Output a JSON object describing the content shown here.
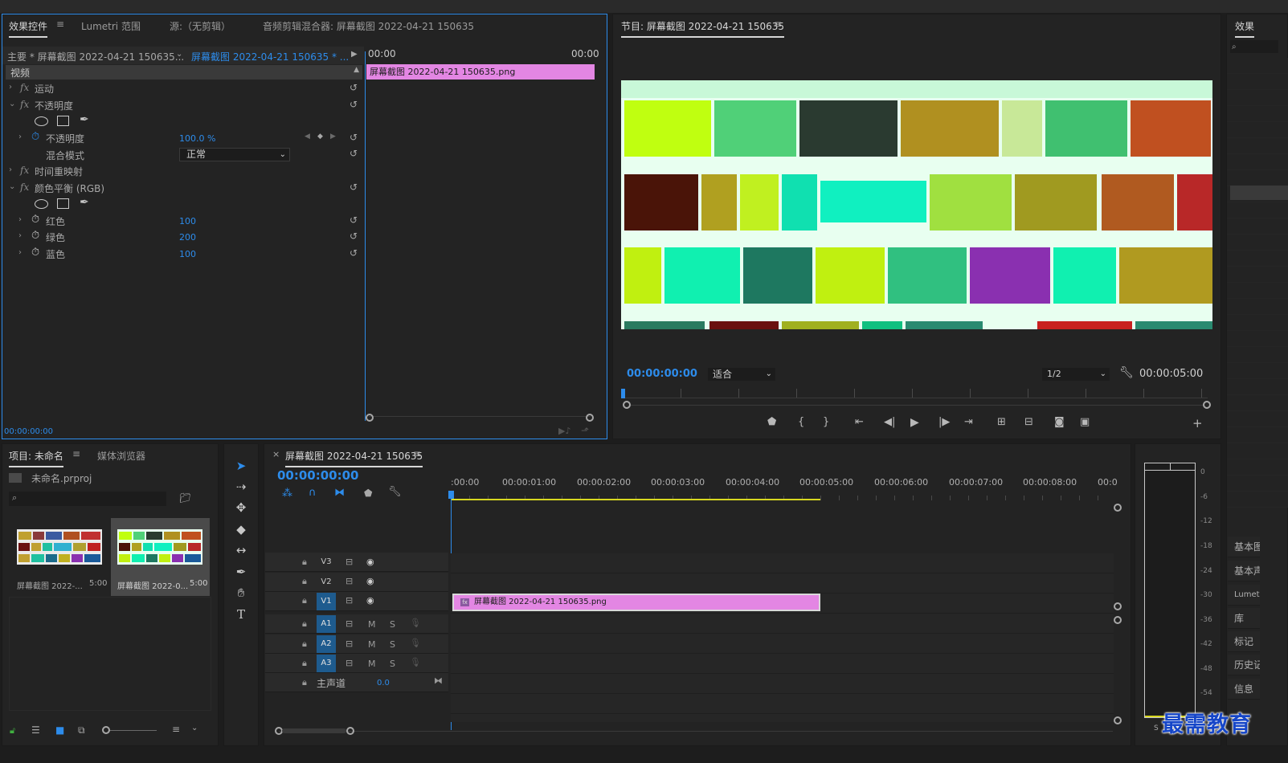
{
  "effects_panel": {
    "tabs": [
      "效果控件",
      "Lumetri 范围",
      "源:（无剪辑）",
      "音频剪辑混合器: 屏幕截图 2022-04-21 150635"
    ],
    "master_label": "主要 * 屏幕截图 2022-04-21 150635...",
    "clip_label": "屏幕截图 2022-04-21 150635 * ...",
    "ruler_start": "00:00",
    "ruler_end": "00:00",
    "clip_bar": "屏幕截图 2022-04-21  150635.png",
    "section_video": "视频",
    "motion": "运动",
    "opacity": "不透明度",
    "opacity_prop": "不透明度",
    "opacity_value": "100.0 %",
    "blend_mode_label": "混合模式",
    "blend_mode_value": "正常",
    "time_remap": "时间重映射",
    "color_balance": "颜色平衡 (RGB)",
    "red_label": "红色",
    "red_value": "100",
    "green_label": "绿色",
    "green_value": "200",
    "blue_label": "蓝色",
    "blue_value": "100",
    "timecode": "00:00:00:00"
  },
  "program_monitor": {
    "title": "节目: 屏幕截图 2022-04-21 150635",
    "timecode": "00:00:00:00",
    "fit": "适合",
    "quality": "1/2",
    "duration": "00:00:05:00"
  },
  "right_panel": {
    "title": "效果",
    "items": [
      "基本图",
      "基本声",
      "Lumetri",
      "库",
      "标记",
      "历史记",
      "信息"
    ]
  },
  "project_panel": {
    "tabs": [
      "项目: 未命名",
      "媒体浏览器"
    ],
    "project_file": "未命名.prproj",
    "search_placeholder": "",
    "items": [
      {
        "name": "屏幕截图 2022-...",
        "duration": "5:00"
      },
      {
        "name": "屏幕截图 2022-0...",
        "duration": "5:00"
      }
    ]
  },
  "timeline": {
    "title": "屏幕截图 2022-04-21 150635",
    "close": "×",
    "timecode": "00:00:00:00",
    "ruler": [
      ":00:00",
      "00:00:01:00",
      "00:00:02:00",
      "00:00:03:00",
      "00:00:04:00",
      "00:00:05:00",
      "00:00:06:00",
      "00:00:07:00",
      "00:00:08:00",
      "00:0"
    ],
    "video_tracks": [
      "V3",
      "V2",
      "V1"
    ],
    "audio_tracks": [
      "A1",
      "A2",
      "A3"
    ],
    "mute": "M",
    "solo": "S",
    "master_label": "主声道",
    "master_value": "0.0",
    "clip_name": "屏幕截图 2022-04-21  150635.png"
  },
  "audio_meter": {
    "scale": [
      "0",
      "-6",
      "-12",
      "-18",
      "-24",
      "-30",
      "-36",
      "-42",
      "-48",
      "-54"
    ],
    "solo_label": "S"
  },
  "watermark": "最需教育",
  "colors": {
    "accent_blue": "#2d8ceb",
    "clip_pink": "#e386e3",
    "track_blue": "#1e5b8e",
    "work_area_yellow": "#d8d820"
  }
}
